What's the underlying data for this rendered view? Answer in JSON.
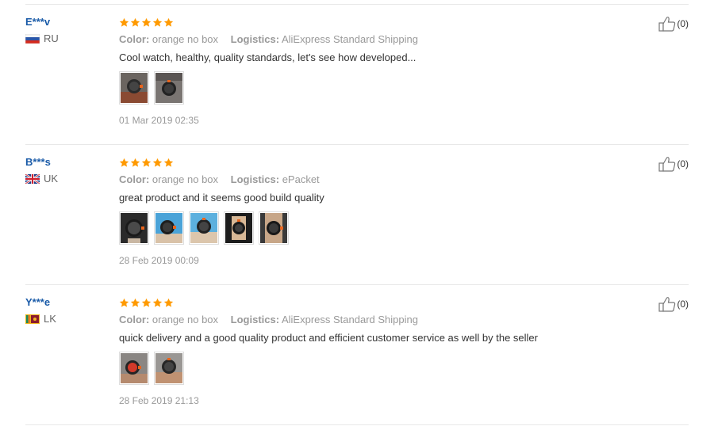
{
  "colors": {
    "username": "#1a5ba8",
    "star": "#ff9a00",
    "muted": "#999999"
  },
  "reviews": [
    {
      "user": "E***v",
      "country_code": "RU",
      "flag": "russia-flag-icon",
      "rating": 5,
      "color_label": "Color:",
      "color_value": "orange no box",
      "logistics_label": "Logistics:",
      "logistics_value": "AliExpress Standard Shipping",
      "text": "Cool watch, healthy, quality standards, let's see how developed...",
      "photo_count": 2,
      "date": "01 Mar 2019 02:35",
      "helpful_count": "(0)"
    },
    {
      "user": "B***s",
      "country_code": "UK",
      "flag": "uk-flag-icon",
      "rating": 5,
      "color_label": "Color:",
      "color_value": "orange no box",
      "logistics_label": "Logistics:",
      "logistics_value": "ePacket",
      "text": "great product and it seems good build quality",
      "photo_count": 5,
      "date": "28 Feb 2019 00:09",
      "helpful_count": "(0)"
    },
    {
      "user": "Y***e",
      "country_code": "LK",
      "flag": "sri-lanka-flag-icon",
      "rating": 5,
      "color_label": "Color:",
      "color_value": "orange no box",
      "logistics_label": "Logistics:",
      "logistics_value": "AliExpress Standard Shipping",
      "text": "quick delivery and a good quality product and efficient customer service as well by the seller",
      "photo_count": 2,
      "date": "28 Feb 2019 21:13",
      "helpful_count": "(0)"
    }
  ]
}
